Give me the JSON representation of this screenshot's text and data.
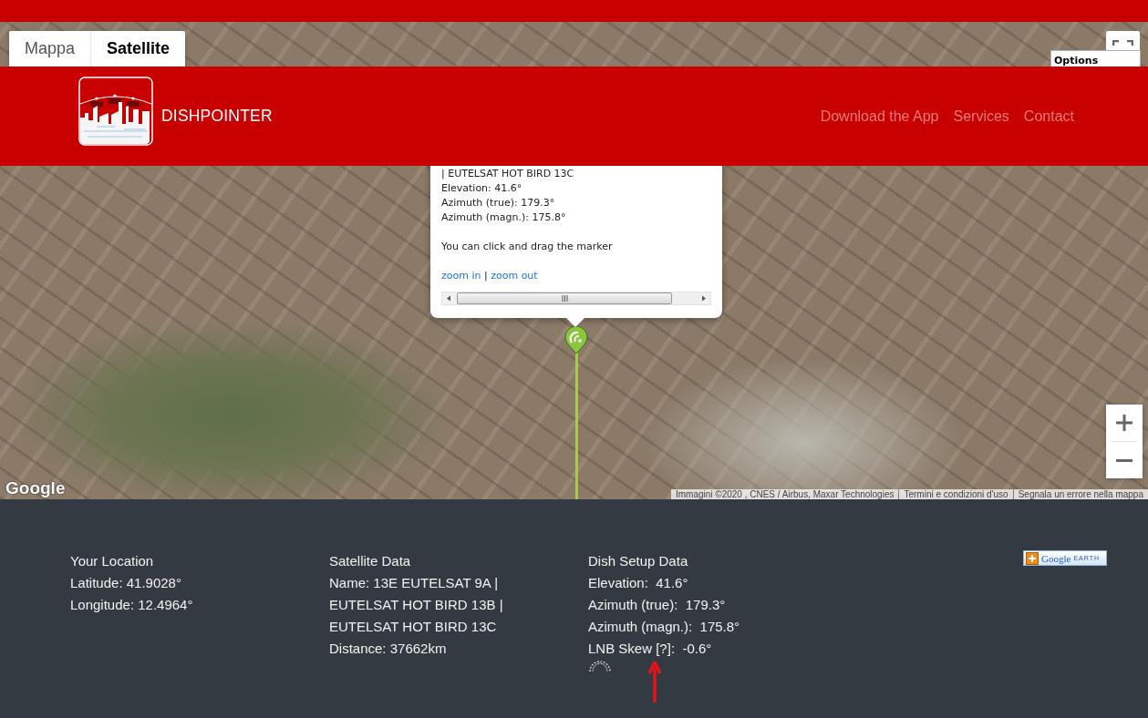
{
  "map": {
    "type_tabs": [
      {
        "label": "Mappa",
        "selected": false
      },
      {
        "label": "Satellite",
        "selected": true
      }
    ],
    "options_label": "Options",
    "popup": {
      "lines": [
        "| EUTELSAT HOT BIRD 13C",
        "Elevation: 41.6°",
        "Azimuth (true): 179.3°",
        "Azimuth (magn.): 175.8°"
      ],
      "hint": "You can click and drag the marker",
      "zoom_links": [
        "zoom in",
        "zoom out"
      ],
      "link_separator": "|"
    },
    "google_logo": "Google",
    "attribution": [
      "Immagini ©2020 , CNES / Airbus, Maxar Technologies",
      "Termini e condizioni d'uso",
      "Segnala un errore nella mappa"
    ]
  },
  "navbar": {
    "brand": "DISHPOINTER",
    "links": [
      "Download the App",
      "Services",
      "Contact"
    ]
  },
  "footer": {
    "columns": [
      {
        "kind": "location",
        "title": "Your Location",
        "lines": [
          {
            "text": "Latitude: 41.9028°"
          },
          {
            "text": "Longitude: 12.4964°"
          }
        ]
      },
      {
        "kind": "satellite",
        "title": "Satellite Data",
        "lines": [
          {
            "text": "Name: 13E EUTELSAT 9A | EUTELSAT HOT BIRD 13B | EUTELSAT HOT BIRD 13C"
          },
          {
            "text": "Distance: 37662km"
          }
        ]
      },
      {
        "kind": "dish",
        "title": "Dish Setup Data",
        "lines": [
          {
            "text": "Elevation:  41.6°"
          },
          {
            "text": "Azimuth (true):  179.3°"
          },
          {
            "text": "Azimuth (magn.):  175.8°"
          },
          {
            "text": "LNB Skew ",
            "link": "[?]",
            "after": ":  -0.6°"
          }
        ]
      }
    ],
    "earth_button": {
      "brand": "Google",
      "product": "EARTH"
    }
  }
}
